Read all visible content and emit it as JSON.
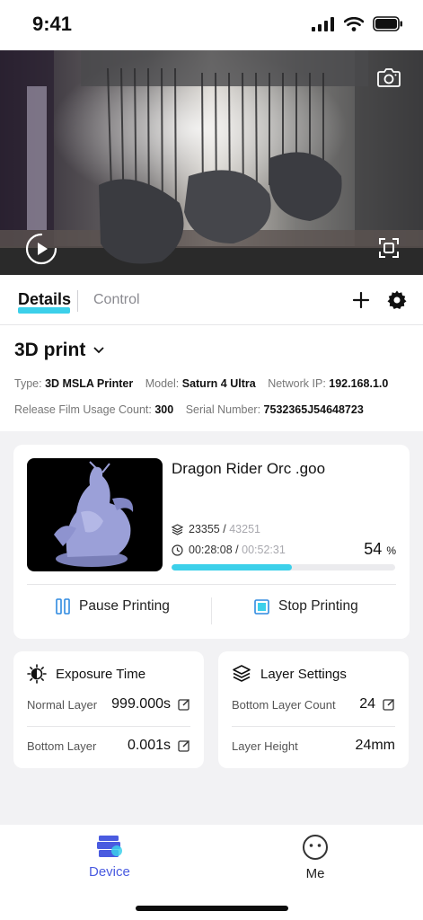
{
  "status_bar": {
    "time": "9:41"
  },
  "tabs": {
    "details": "Details",
    "control": "Control"
  },
  "printer": {
    "name": "3D print",
    "type_label": "Type:",
    "type": "3D MSLA Printer",
    "model_label": "Model:",
    "model": "Saturn 4 Ultra",
    "ip_label": "Network IP:",
    "ip": "192.168.1.0",
    "film_label": "Release Film Usage Count:",
    "film_count": "300",
    "serial_label": "Serial Number:",
    "serial": "7532365J54648723"
  },
  "job": {
    "file_name": "Dragon Rider Orc .goo",
    "current_layer": "23355",
    "separator": "/",
    "total_layers": "43251",
    "elapsed": "00:28:08",
    "total_time": "00:52:31",
    "percent": "54",
    "percent_sign": "%",
    "progress": 0.54,
    "pause_label": "Pause Printing",
    "stop_label": "Stop Printing"
  },
  "exposure": {
    "title": "Exposure Time",
    "normal_label": "Normal Layer",
    "normal_value": "999.000s",
    "bottom_label": "Bottom Layer",
    "bottom_value": "0.001s"
  },
  "layer_settings": {
    "title": "Layer Settings",
    "bottom_count_label": "Bottom Layer Count",
    "bottom_count": "24",
    "height_label": "Layer Height",
    "height": "24mm"
  },
  "nav": {
    "device": "Device",
    "me": "Me"
  },
  "colors": {
    "accent": "#3cd0ea",
    "active_nav": "#4a5be0"
  },
  "icons": [
    "signal-icon",
    "wifi-icon",
    "battery-icon",
    "camera-snapshot-icon",
    "play-icon",
    "fullscreen-icon",
    "plus-icon",
    "gear-icon",
    "chevron-down-icon",
    "layers-icon",
    "clock-icon",
    "pause-icon",
    "stop-icon",
    "edit-icon",
    "brightness-icon",
    "layer-stack-icon",
    "device-icon",
    "me-icon"
  ]
}
